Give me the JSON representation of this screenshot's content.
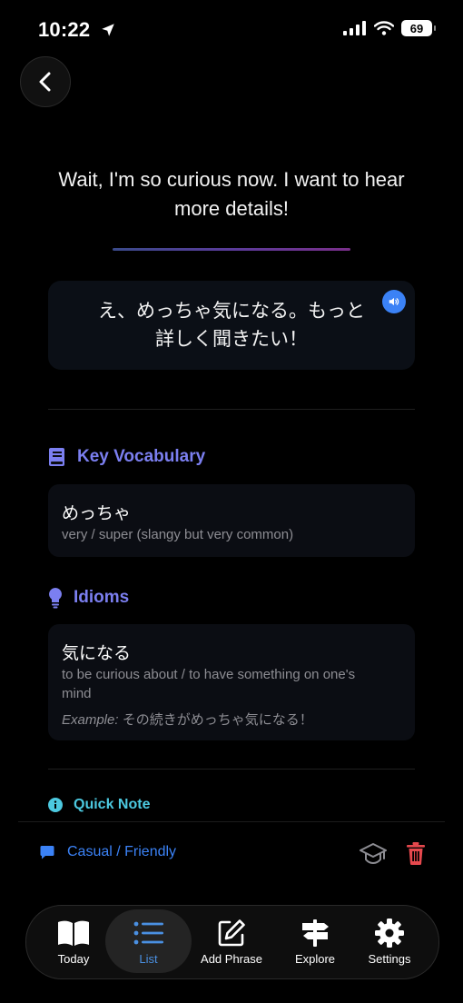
{
  "status_bar": {
    "time": "10:22",
    "battery": "69"
  },
  "phrase": {
    "english": "Wait, I'm so curious now. I want to hear more details!",
    "japanese": "え、めっちゃ気になる。もっと\n詳しく聞きたい！"
  },
  "vocabulary": {
    "title": "Key Vocabulary",
    "items": [
      {
        "term": "めっちゃ",
        "meaning": "very / super (slangy but very common)"
      }
    ]
  },
  "idioms": {
    "title": "Idioms",
    "items": [
      {
        "term": "気になる",
        "meaning": "to be curious about / to have something on one's mind",
        "example_label": "Example:",
        "example": "その続きがめっちゃ気になる！"
      }
    ]
  },
  "quick_note": {
    "title": "Quick Note"
  },
  "tone": {
    "label": "Casual / Friendly"
  },
  "tabs": [
    {
      "label": "Today",
      "icon": "book-open-icon"
    },
    {
      "label": "List",
      "icon": "list-icon",
      "active": true
    },
    {
      "label": "Add Phrase",
      "icon": "edit-icon"
    },
    {
      "label": "Explore",
      "icon": "signpost-icon"
    },
    {
      "label": "Settings",
      "icon": "gear-icon"
    }
  ],
  "colors": {
    "accent_blue": "#3b82f6",
    "section_purple": "#7b7ff0",
    "note_cyan": "#4cc9e0",
    "delete_red": "#e5484d"
  }
}
